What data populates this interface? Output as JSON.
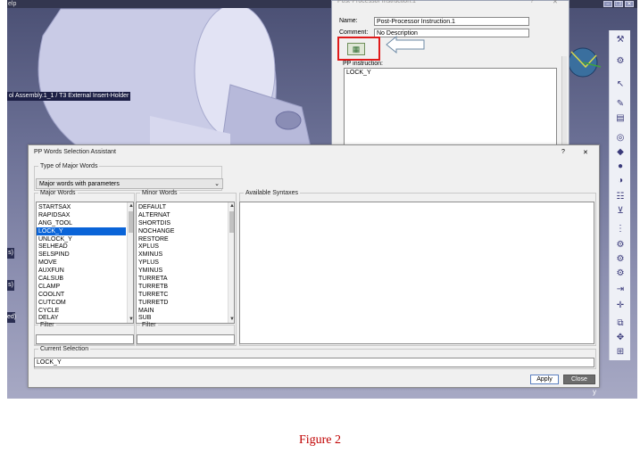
{
  "viewport": {
    "menu_left": "elp",
    "tree_label": "ol Assembly.1_1 / T3 External Insert-Holder",
    "edge_labels": [
      "s)",
      "s)",
      "ed)"
    ],
    "axis_label": "y"
  },
  "pp_instruction": {
    "title": "Post-Processor Instruction.1",
    "name_label": "Name:",
    "name_value": "Post-Processor Instruction.1",
    "comment_label": "Comment:",
    "comment_value": "No Description",
    "instruction_label": "PP instruction:",
    "instruction_value": "LOCK_Y",
    "help_glyph": "?",
    "close_glyph": "✕"
  },
  "pp_words": {
    "title": "PP Words Selection Assistant",
    "help_glyph": "?",
    "close_glyph": "✕",
    "type_group_label": "Type of Major Words",
    "type_selected": "Major words with parameters",
    "major_label": "Major Words",
    "major_words": [
      "STARTSAX",
      "RAPIDSAX",
      "ANG_TOOL",
      "LOCK_Y",
      "UNLOCK_Y",
      "SELHEAD",
      "SELSPIND",
      "MOVE",
      "AUXFUN",
      "CALSUB",
      "CLAMP",
      "COOLNT",
      "CUTCOM",
      "CYCLE",
      "DELAY"
    ],
    "major_selected_index": 3,
    "minor_label": "Minor Words",
    "minor_words": [
      "DEFAULT",
      "ALTERNAT",
      "SHORTDIS",
      "NOCHANGE",
      "RESTORE",
      "XPLUS",
      "XMINUS",
      "YPLUS",
      "YMINUS",
      "TURRETA",
      "TURRETB",
      "TURRETC",
      "TURRETD",
      "MAIN",
      "SUB"
    ],
    "syntaxes_label": "Available Syntaxes",
    "filter_label": "Filter",
    "current_label": "Current Selection",
    "current_value": "LOCK_Y",
    "apply_label": "Apply",
    "close_label": "Close"
  },
  "caption": "Figure 2",
  "colors": {
    "selection": "#0a64d8",
    "highlight_box": "#e01a1a",
    "caption": "#c00000"
  }
}
